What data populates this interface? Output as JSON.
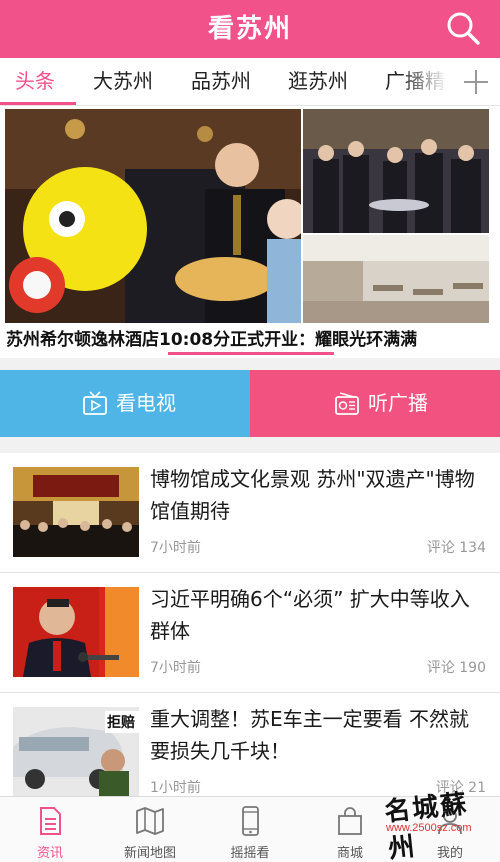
{
  "header": {
    "title": "看苏州",
    "search_icon": "search-icon"
  },
  "tabs": [
    {
      "label": "头条",
      "active": true
    },
    {
      "label": "大苏州"
    },
    {
      "label": "品苏州"
    },
    {
      "label": "逛苏州"
    },
    {
      "label": "广播精"
    }
  ],
  "tabs_add_icon": "plus-icon",
  "banner": {
    "caption": "苏州希尔顿逸林酒店10:08分正式开业：耀眼光环满满"
  },
  "quick_actions": {
    "tv_label": "看电视",
    "tv_icon": "tv-icon",
    "radio_label": "听广播",
    "radio_icon": "radio-icon",
    "tv_color": "#4fb4e6",
    "radio_color": "#f1527f"
  },
  "news": [
    {
      "title": "博物馆成文化景观 苏州\"双遗产\"博物馆值期待",
      "time": "7小时前",
      "comments": "评论 134"
    },
    {
      "title": "习近平明确6个“必须” 扩大中等收入群体",
      "time": "7小时前",
      "comments": "评论 190"
    },
    {
      "title": "重大调整！苏E车主一定要看 不然就要损失几千块！",
      "time": "1小时前",
      "comments": "评论 21",
      "thumb_text": "拒赔"
    }
  ],
  "bottom_nav": [
    {
      "label": "资讯",
      "icon": "news-doc-icon",
      "active": true
    },
    {
      "label": "新闻地图",
      "icon": "map-icon"
    },
    {
      "label": "摇摇看",
      "icon": "phone-icon"
    },
    {
      "label": "商城",
      "icon": "shopping-bag-icon"
    },
    {
      "label": "我的",
      "icon": "user-icon"
    }
  ],
  "watermark": {
    "main": "名城蘇州",
    "sub": "www.2500sz.com"
  },
  "colors": {
    "accent": "#f2528a",
    "tv": "#4fb4e6",
    "radio": "#f1527f"
  }
}
